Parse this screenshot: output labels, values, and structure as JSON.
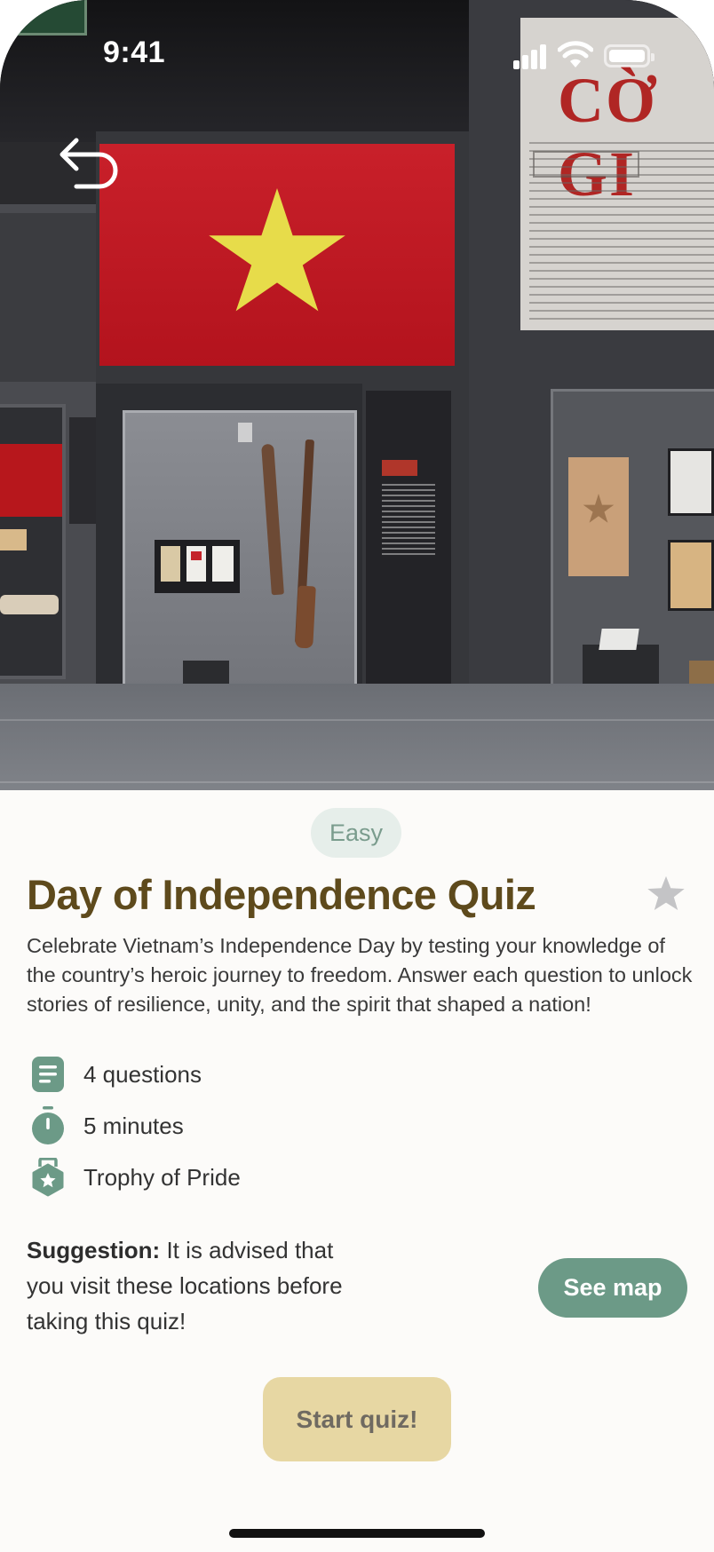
{
  "status_bar": {
    "time": "9:41"
  },
  "hero": {
    "newspaper_headline": "CỜ GI"
  },
  "quiz": {
    "difficulty": "Easy",
    "title": "Day of Independence Quiz",
    "description": "Celebrate Vietnam’s Independence Day by testing your knowledge of the country’s heroic journey to freedom. Answer each question to unlock stories of resilience, unity, and the spirit that shaped a nation!",
    "favorited": false,
    "details": [
      {
        "icon": "document-list-icon",
        "text": "4 questions"
      },
      {
        "icon": "stopwatch-icon",
        "text": "5 minutes"
      },
      {
        "icon": "medal-icon",
        "text": "Trophy of Pride"
      }
    ]
  },
  "suggestion": {
    "label": "Suggestion:",
    "text": " It is advised that you visit these locations before taking this quiz!"
  },
  "buttons": {
    "see_map": "See map",
    "start_quiz": "Start quiz!"
  },
  "colors": {
    "title": "#5E4A1C",
    "accent_green": "#6C9A87",
    "badge_bg": "#E6EEEA",
    "start_button_bg": "#E7D7A3",
    "sheet_bg": "#FCFBF9"
  }
}
